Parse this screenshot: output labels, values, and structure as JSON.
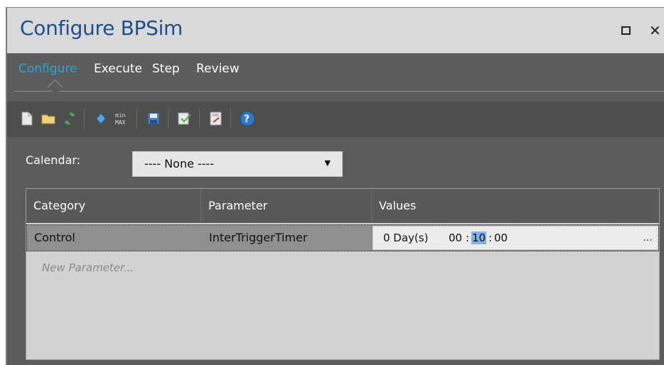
{
  "window": {
    "title": "Configure BPSim",
    "restore_label": "restore",
    "close_label": "✕"
  },
  "tabs": [
    {
      "label": "Configure",
      "active": true
    },
    {
      "label": "Execute",
      "active": false
    },
    {
      "label": "Step",
      "active": false
    },
    {
      "label": "Review",
      "active": false
    }
  ],
  "toolbar": {
    "icons": [
      "new-document-icon",
      "open-folder-icon",
      "refresh-icon",
      "parameter-icon",
      "min-max-icon",
      "save-icon",
      "validate-icon",
      "export-xml-icon",
      "help-icon"
    ]
  },
  "calendar": {
    "label": "Calendar:",
    "value": "---- None ----"
  },
  "grid": {
    "columns": [
      "Category",
      "Parameter",
      "Values"
    ],
    "rows": [
      {
        "category": "Control",
        "parameter": "InterTriggerTimer",
        "value_days": "0 Day(s)",
        "value_hours": "00",
        "value_minutes": "10",
        "value_seconds": "00",
        "ellipsis": "..."
      }
    ],
    "new_parameter_placeholder": "New Parameter..."
  },
  "colors": {
    "title": "#1f4e8c",
    "active_tab": "#2ba5d8",
    "panel_bg": "#5c5c5c",
    "selection": "#7fb3e4"
  }
}
